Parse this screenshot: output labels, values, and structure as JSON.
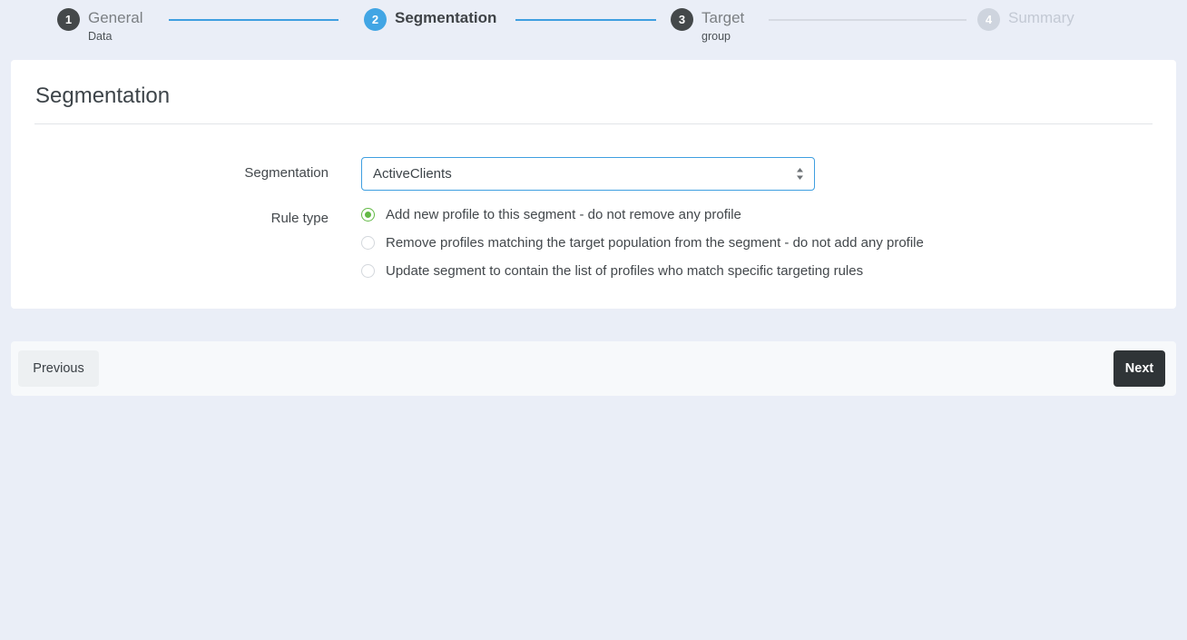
{
  "stepper": {
    "steps": [
      {
        "number": "1",
        "label": "General",
        "sublabel": "Data",
        "state": "done"
      },
      {
        "number": "2",
        "label": "Segmentation",
        "sublabel": "",
        "state": "active"
      },
      {
        "number": "3",
        "label": "Target",
        "sublabel": "group",
        "state": "done"
      },
      {
        "number": "4",
        "label": "Summary",
        "sublabel": "",
        "state": "todo"
      }
    ],
    "connector_active_color": "#3f9fe0",
    "connector_inactive_color": "#d6dae2"
  },
  "card": {
    "title": "Segmentation"
  },
  "form": {
    "segmentation": {
      "label": "Segmentation",
      "value": "ActiveClients",
      "icon": "chevron-up-down-icon"
    },
    "rule_type": {
      "label": "Rule type",
      "options": [
        {
          "text": "Add new profile to this segment - do not remove any profile",
          "selected": true
        },
        {
          "text": "Remove profiles matching the target population from the segment - do not add any profile",
          "selected": false
        },
        {
          "text": "Update segment to contain the list of profiles who match specific targeting rules",
          "selected": false
        }
      ],
      "selected_color": "#62b945"
    }
  },
  "footer": {
    "previous_label": "Previous",
    "next_label": "Next"
  },
  "colors": {
    "page_background": "#eaeef7",
    "accent_blue": "#41a5e4",
    "next_button": "#2f3437"
  }
}
